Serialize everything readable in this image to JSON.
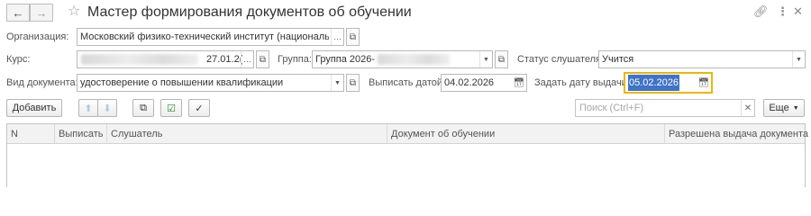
{
  "window": {
    "back_icon": "arrow-left-icon",
    "forward_icon": "arrow-right-icon",
    "favorite_icon": "star-icon",
    "title": "Мастер формирования документов об обучении",
    "link_icon": "link-icon",
    "more_icon": "more-vertical-icon",
    "close_icon": "close-icon"
  },
  "form": {
    "organization": {
      "label": "Организация:",
      "value": "Московский физико-технический институт (национальный ис"
    },
    "course": {
      "label": "Курс:",
      "value_visible": "27.01.2("
    },
    "group": {
      "label": "Группа:",
      "value": "Группа 2026-"
    },
    "listener_status": {
      "label": "Статус слушателя:",
      "value": "Учится"
    },
    "doc_type": {
      "label": "Вид документа:",
      "value": "удостоверение о повышении квалификации"
    },
    "issue_date": {
      "label": "Выписать датой:",
      "value": "04.02.2026"
    },
    "issue_given_date": {
      "label": "Задать дату выдачи:",
      "value": "05.02.2026"
    }
  },
  "toolbar": {
    "add_label": "Добавить",
    "more_label": "Еще",
    "search_placeholder": "Поиск (Ctrl+F)",
    "move_up_icon": "arrow-up-icon",
    "move_down_icon": "arrow-down-icon",
    "copy_icon": "copy-icon",
    "check_all_icon": "check-all-icon",
    "check_icon": "checkbox-check-icon"
  },
  "table": {
    "columns": [
      "N",
      "Выписать",
      "Слушатель",
      "Документ об обучении",
      "Разрешена выдача документа"
    ],
    "rows": []
  },
  "colors": {
    "selected_field_border": "#e8b800",
    "selected_text_bg": "#3f73c6"
  }
}
